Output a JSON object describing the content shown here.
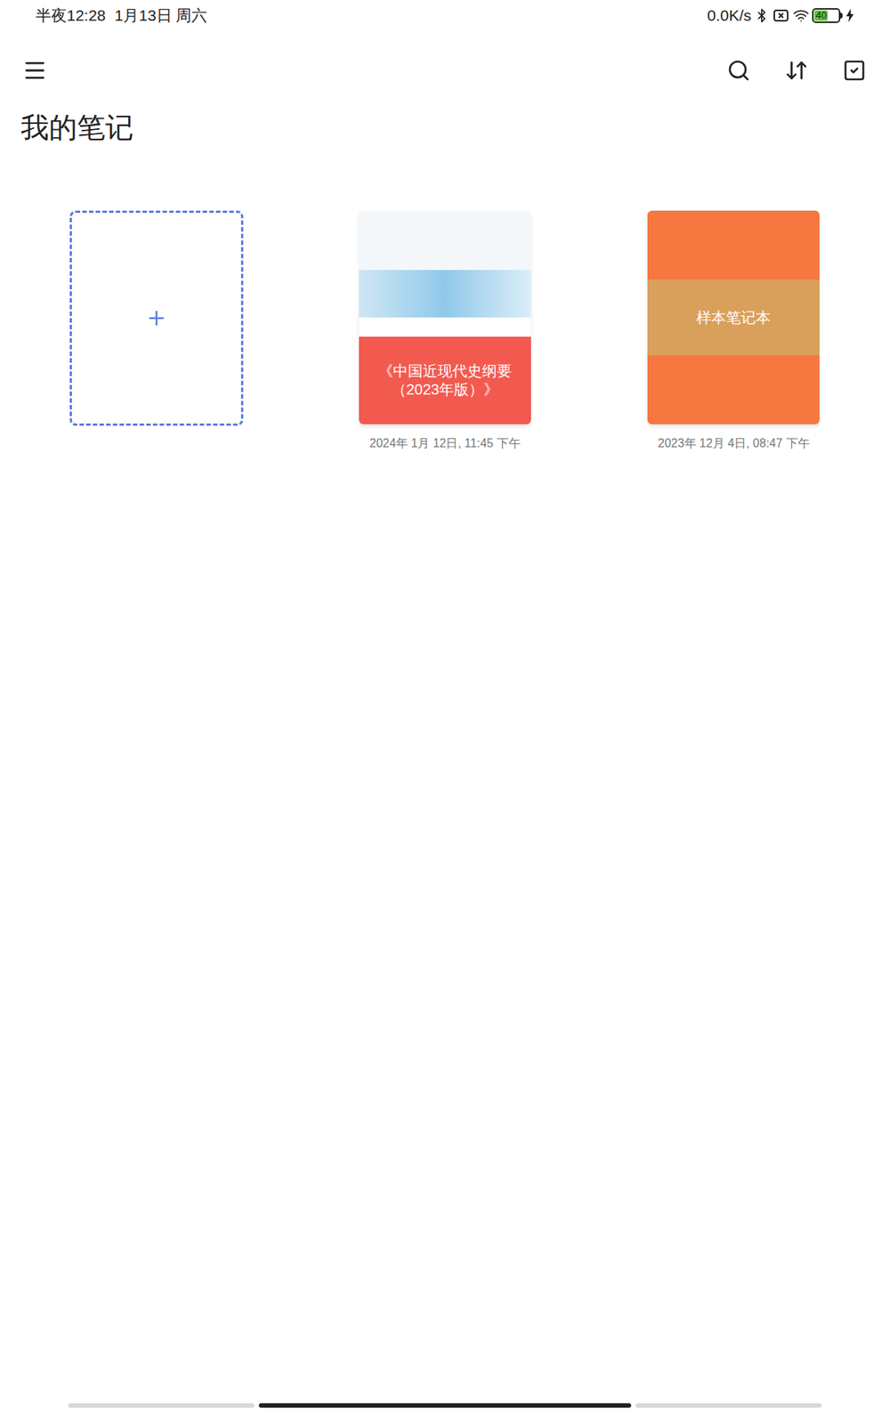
{
  "status_bar": {
    "time": "半夜12:28",
    "date": "1月13日 周六",
    "speed": "0.0K/s",
    "battery": "40",
    "charging": true
  },
  "title": "我的笔记",
  "notebooks": [
    {
      "title": "《中国近现代史纲要（2023年版）》",
      "date": "2024年 1月 12日, 11:45 下午",
      "kind": "photo",
      "color": "#f25a4f"
    },
    {
      "title": "样本笔记本",
      "date": "2023年 12月 4日, 08:47 下午",
      "kind": "plain",
      "color": "#f6773f"
    }
  ],
  "nav_bar": [
    {
      "selected": false
    },
    {
      "selected": true
    },
    {
      "selected": false
    }
  ]
}
